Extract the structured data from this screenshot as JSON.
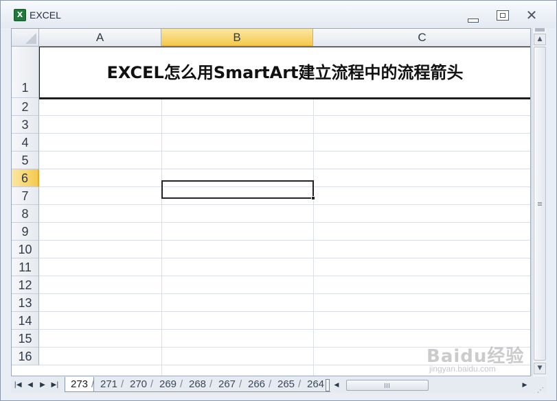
{
  "window": {
    "title": "EXCEL",
    "app_icon_glyph": "X",
    "minimize_icon": "minimize-icon",
    "maximize_icon": "maximize-icon",
    "close_icon": "close-icon"
  },
  "columns": [
    {
      "label": "A",
      "selected": false
    },
    {
      "label": "B",
      "selected": true
    },
    {
      "label": "C",
      "selected": false
    }
  ],
  "rows": [
    "1",
    "2",
    "3",
    "4",
    "5",
    "6",
    "7",
    "8",
    "9",
    "10",
    "11",
    "12",
    "13",
    "14",
    "15",
    "16"
  ],
  "active_row": "6",
  "cells": {
    "title": "EXCEL怎么用SmartArt建立流程中的流程箭头"
  },
  "sheet_tabs": [
    "273",
    "271",
    "270",
    "269",
    "268",
    "267",
    "266",
    "265",
    "264"
  ],
  "active_tab": "273",
  "watermark": {
    "text": "Baidu经验",
    "sub": "jingyan.baidu.com"
  },
  "colors": {
    "header_selected": "#f5c94e",
    "gridline": "#dadfe6",
    "window_bg": "#e9eef5"
  }
}
